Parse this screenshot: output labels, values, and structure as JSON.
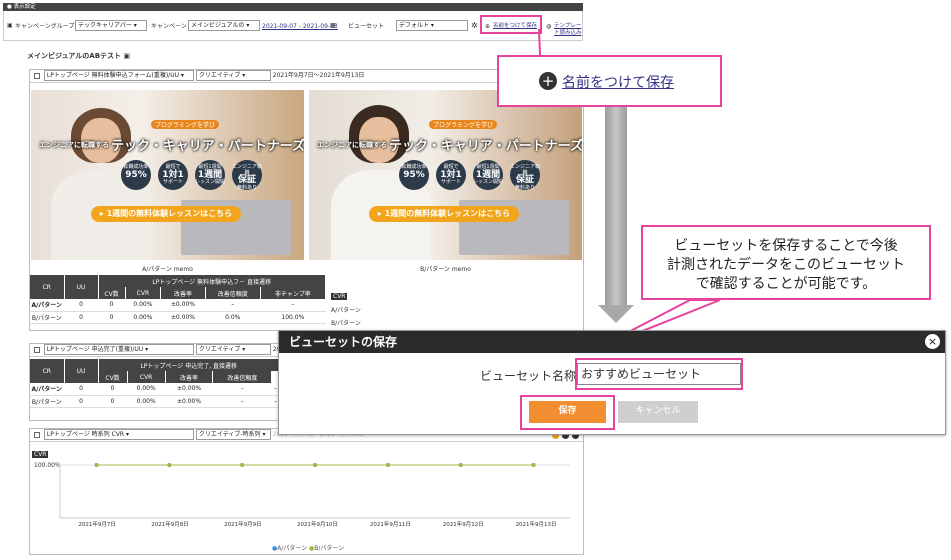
{
  "settings": {
    "header": "表示設定",
    "campaign_group_label": "キャンペーングループ",
    "campaign_group_value": "テックキャリアパー",
    "campaign_label": "キャンペーン",
    "campaign_value": "メインビジュアルの",
    "date_range": "2021-09-07 - 2021-09-13",
    "view_set_label": "ビューセット",
    "view_set_value": "デフォルト",
    "save_named": "名前をつけて保存",
    "load_template": "テンプレート読み込み"
  },
  "page_title": "メインビジュアルのABテスト",
  "panel1": {
    "metric_select": "LPトップページ 無料体験申込フォーム(重複)/UU",
    "type_select": "クリエイティブ",
    "date_text": "2021年9月7日～2021年9月13日",
    "creatives": [
      {
        "pre": "プログラミングを学び",
        "lead": "エンジニアに転職する",
        "headline": "テック・キャリア・パートナーズ",
        "badges": [
          [
            "転職成功率",
            "95%"
          ],
          [
            "最短で",
            "1対1",
            "サポート"
          ],
          [
            "最短1週間",
            "1週間",
            "レッスン開始"
          ],
          [
            "エンジニア転職",
            "保証",
            "無料あり"
          ]
        ],
        "cta": "1週間の無料体験レッスンはこちら",
        "caption": "A/パターン memo"
      },
      {
        "pre": "プログラミングを学び",
        "lead": "エンジニアに転職する",
        "headline": "テック・キャリア・パートナーズ",
        "badges": [
          [
            "転職成功率",
            "95%"
          ],
          [
            "最短で",
            "1対1",
            "サポート"
          ],
          [
            "最短1週間",
            "1週間",
            "レッスン開始"
          ],
          [
            "エンジニア転職",
            "保証",
            "無料あり"
          ]
        ],
        "cta": "1週間の無料体験レッスンはこちら",
        "caption": "B/パターン memo"
      }
    ],
    "table": {
      "group_header": "LPトップページ 無料体験申込フ－ 直接遷移",
      "cols": [
        "CR",
        "UU",
        "CV数",
        "CVR",
        "改善率",
        "改善信頼度",
        "非チャンプ率"
      ],
      "rows": [
        [
          "A/パターン",
          "0",
          "0",
          "0.00%",
          "±0.00%",
          "–",
          "–",
          ""
        ],
        [
          "B/パターン",
          "0",
          "0",
          "0.00%",
          "±0.00%",
          "–",
          "0.0%",
          "100.0%"
        ]
      ],
      "cvr_tag": "CVR",
      "legend": [
        "A/パターン",
        "B/パターン"
      ]
    }
  },
  "panel2": {
    "metric_select": "LPトップページ 申込完了(重複)/UU",
    "type_select": "クリエイティブ",
    "date_text": "2021年",
    "table": {
      "group_header": "LPトップページ 申込完了, 直接遷移",
      "cols": [
        "CR",
        "UU",
        "CV数",
        "CVR",
        "改善率",
        "改善信頼度"
      ],
      "rows": [
        [
          "A/パターン",
          "0",
          "0",
          "0.00%",
          "±0.00%",
          "–",
          "–"
        ],
        [
          "B/パターン",
          "0",
          "0",
          "0.00%",
          "±0.00%",
          "–",
          "–"
        ]
      ]
    }
  },
  "panel3": {
    "metric_select": "LPトップページ 時系列 CVR",
    "type_select": "クリエイティブ-時系列",
    "date_text": "2021年9月7日～2021年9月13日",
    "cvr_tag": "CVR",
    "y_tick": "100.00%",
    "legend": [
      "A/パターン",
      "B/パターン"
    ]
  },
  "chart_data": {
    "type": "line",
    "x": [
      "2021年9月7日",
      "2021年9月8日",
      "2021年9月9日",
      "2021年9月10日",
      "2021年9月11日",
      "2021年9月12日",
      "2021年9月13日"
    ],
    "series": [
      {
        "name": "A/パターン",
        "values": [
          100,
          100,
          100,
          100,
          100,
          100,
          100
        ]
      },
      {
        "name": "B/パターン",
        "values": [
          100,
          100,
          100,
          100,
          100,
          100,
          100
        ]
      }
    ],
    "ylabel": "CVR",
    "ylim": [
      0,
      100
    ],
    "colors": {
      "A/パターン": "#3a8fd8",
      "B/パターン": "#a7b544"
    }
  },
  "callout_save": "名前をつけて保存",
  "callout_text": [
    "ビューセットを保存することで今後",
    "計測されたデータをこのビューセット",
    "で確認することが可能です。"
  ],
  "dialog": {
    "title": "ビューセットの保存",
    "close": "×",
    "name_label": "ビューセット名称",
    "name_value": "おすすめビューセット",
    "save_label": "保存",
    "cancel_label": "キャンセル"
  },
  "colors": {
    "accent": "#e6449c",
    "save_button": "#f28d30",
    "cta": "#f2a51a"
  }
}
